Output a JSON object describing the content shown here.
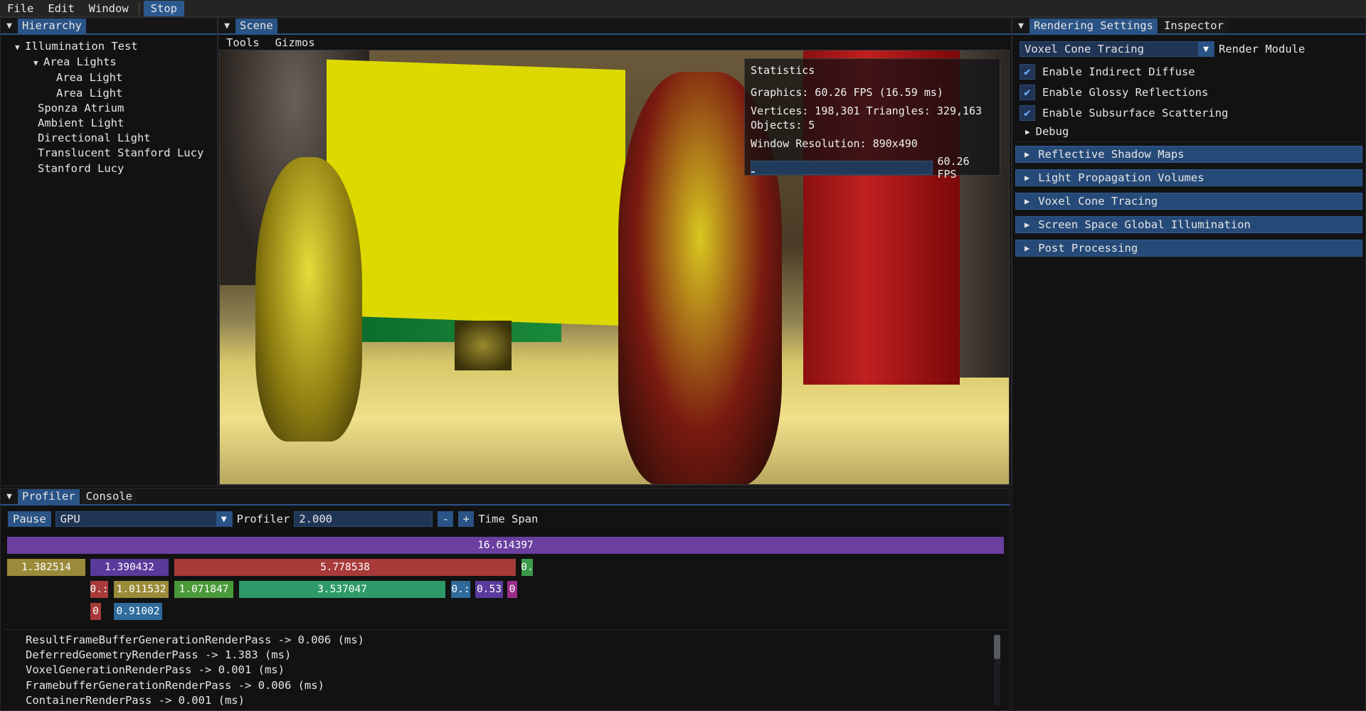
{
  "menubar": {
    "file": "File",
    "edit": "Edit",
    "window": "Window",
    "stop": "Stop"
  },
  "hierarchy": {
    "tab": "Hierarchy",
    "nodes": [
      {
        "label": "Illumination Test",
        "depth": 0,
        "expanded": true
      },
      {
        "label": "Area Lights",
        "depth": 1,
        "expanded": true
      },
      {
        "label": "Area Light",
        "depth": 2
      },
      {
        "label": "Area Light",
        "depth": 2
      },
      {
        "label": "Sponza Atrium",
        "depth": 1
      },
      {
        "label": "Ambient Light",
        "depth": 1
      },
      {
        "label": "Directional Light",
        "depth": 1
      },
      {
        "label": "Translucent Stanford Lucy",
        "depth": 1
      },
      {
        "label": "Stanford Lucy",
        "depth": 1
      }
    ]
  },
  "scene": {
    "tab": "Scene",
    "tools": "Tools",
    "gizmos": "Gizmos",
    "stats": {
      "title": "Statistics",
      "graphics": "Graphics: 60.26 FPS (16.59 ms)",
      "geometry": "Vertices: 198,301 Triangles: 329,163",
      "objects": "Objects: 5",
      "resolution": "Window Resolution: 890x490",
      "fps_label": "60.26 FPS"
    }
  },
  "settings": {
    "tab_rendering": "Rendering Settings",
    "tab_inspector": "Inspector",
    "module_value": "Voxel Cone Tracing",
    "module_label": "Render Module",
    "checkboxes": [
      {
        "label": "Enable Indirect Diffuse",
        "checked": true
      },
      {
        "label": "Enable Glossy Reflections",
        "checked": true
      },
      {
        "label": "Enable Subsurface Scattering",
        "checked": true
      }
    ],
    "debug": "Debug",
    "headers": [
      "Reflective Shadow Maps",
      "Light Propagation Volumes",
      "Voxel Cone Tracing",
      "Screen Space Global Illumination",
      "Post Processing"
    ]
  },
  "profiler": {
    "tab_profiler": "Profiler",
    "tab_console": "Console",
    "pause": "Pause",
    "device": "GPU",
    "profiler_label": "Profiler",
    "time_value": "2.000",
    "minus": "-",
    "plus": "+",
    "time_span_label": "Time Span",
    "flame": [
      {
        "label": "16.614397",
        "color": "#6a3fa0"
      },
      {
        "label": "1.382514",
        "color": "#9a8a3a"
      },
      {
        "label": "1.390432",
        "color": "#5a3a9a"
      },
      {
        "label": "5.778538",
        "color": "#a83a3a"
      },
      {
        "label": "0.",
        "color": "#3a9a4a"
      },
      {
        "label": "0.:",
        "color": "#a83a3a"
      },
      {
        "label": "1.011532",
        "color": "#9a8a3a"
      },
      {
        "label": "1.071847",
        "color": "#4a9a3a"
      },
      {
        "label": "3.537047",
        "color": "#2e9a6a"
      },
      {
        "label": "0.:",
        "color": "#2e6a9a"
      },
      {
        "label": "0.53",
        "color": "#5a3a9a"
      },
      {
        "label": "0",
        "color": "#9a2e8a"
      },
      {
        "label": "0",
        "color": "#a83a3a"
      },
      {
        "label": "0.91002",
        "color": "#2e6a9a"
      }
    ],
    "log": [
      "ResultFrameBufferGenerationRenderPass -> 0.006 (ms)",
      "DeferredGeometryRenderPass -> 1.383 (ms)",
      "VoxelGenerationRenderPass -> 0.001 (ms)",
      "FramebufferGenerationRenderPass -> 0.006 (ms)",
      "ContainerRenderPass -> 0.001 (ms)"
    ],
    "fps_fraction": 0.02
  }
}
